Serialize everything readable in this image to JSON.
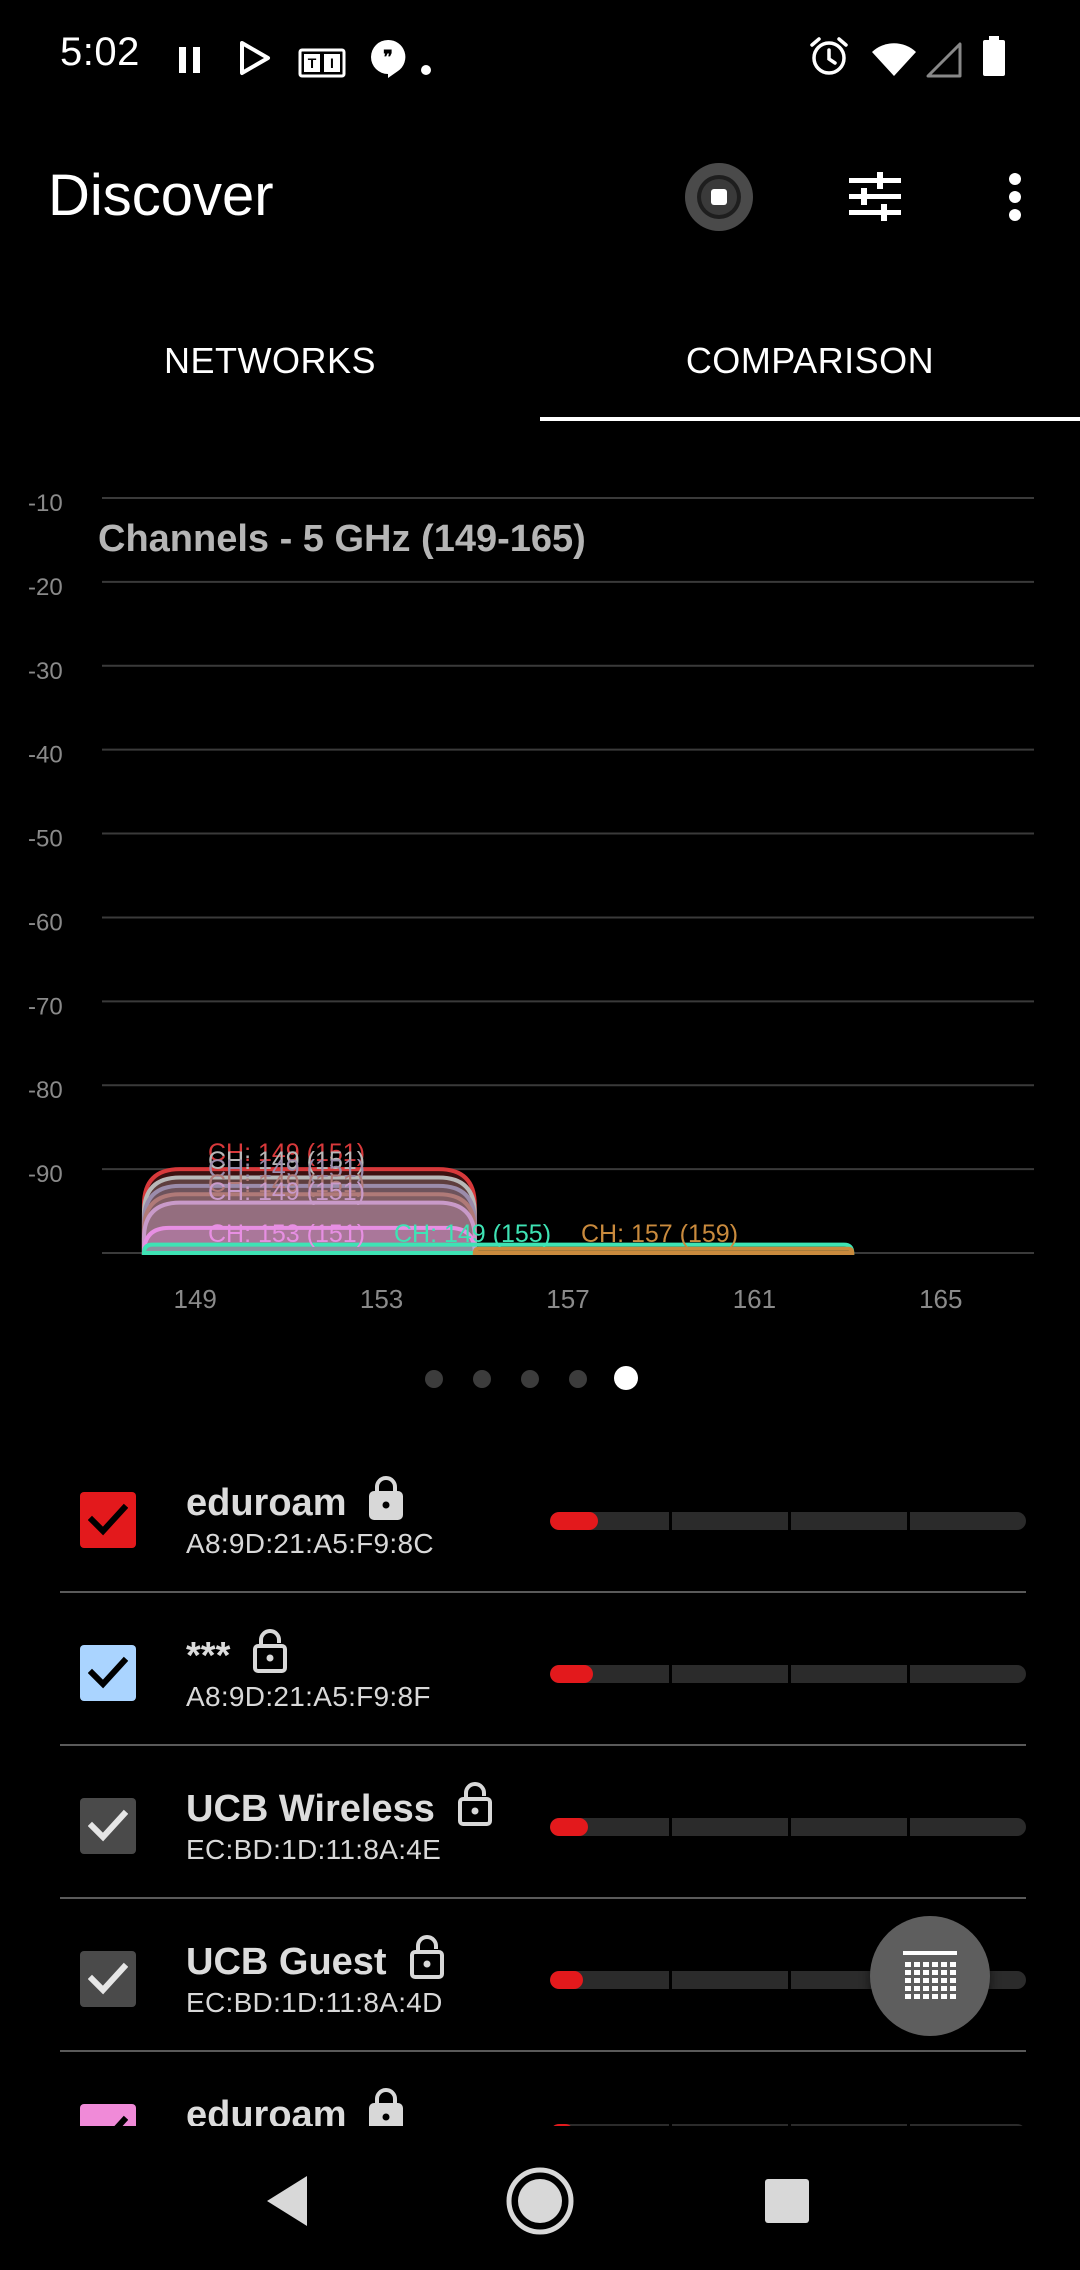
{
  "status_bar": {
    "time": "5:02",
    "icons": [
      "pause-icon",
      "play-icon",
      "news-icon",
      "chat-icon",
      "notification-dot-icon",
      "alarm-icon",
      "wifi-icon",
      "cell-signal-icon",
      "battery-icon"
    ]
  },
  "app_bar": {
    "title": "Discover",
    "actions": [
      "stop-scan-icon",
      "filter-sliders-icon",
      "more-vert-icon"
    ]
  },
  "tabs": [
    {
      "label": "NETWORKS",
      "selected": false
    },
    {
      "label": "COMPARISON",
      "selected": true
    }
  ],
  "chart_data": {
    "type": "area",
    "title": "Channels - 5 GHz (149-165)",
    "y_ticks": [
      "-10",
      "-20",
      "-30",
      "-40",
      "-50",
      "-60",
      "-70",
      "-80",
      "-90"
    ],
    "x_ticks": [
      "149",
      "153",
      "157",
      "161",
      "165"
    ],
    "ylim": [
      -100,
      -10
    ],
    "xlim": [
      147,
      167
    ],
    "grid": true,
    "series": [
      {
        "label": "CH: 149 (151)",
        "x_range": [
          147.9,
          155
        ],
        "rssi": -90,
        "color": "#d8393b"
      },
      {
        "label": "CH: 149 (151)",
        "x_range": [
          147.9,
          155
        ],
        "rssi": -91,
        "color": "#b8b8b8"
      },
      {
        "label": "CH: 149 (151)",
        "x_range": [
          147.9,
          155
        ],
        "rssi": -92,
        "color": "#9b8cab"
      },
      {
        "label": "CH: 149 (151)",
        "x_range": [
          147.9,
          155
        ],
        "rssi": -93,
        "color": "#b07a78"
      },
      {
        "label": "CH: 149 (151)",
        "x_range": [
          147.9,
          155
        ],
        "rssi": -94,
        "color": "#c99ac9"
      },
      {
        "label": "CH: 153 (151)",
        "x_range": [
          147.9,
          155
        ],
        "rssi": -97,
        "color": "#e78fe3"
      },
      {
        "label": "CH: 149 (155)",
        "x_range": [
          147.9,
          163.1
        ],
        "rssi": -99,
        "color": "#3ee3b4"
      },
      {
        "label": "CH: 157 (159)",
        "x_range": [
          155,
          163.1
        ],
        "rssi": -99.5,
        "color": "#c98a3d"
      }
    ]
  },
  "pager": {
    "count": 5,
    "active_index": 4
  },
  "networks": [
    {
      "ssid": "eduroam",
      "bssid": "A8:9D:21:A5:F9:8C",
      "checkbox_color": "#e3191c",
      "check_color": "#000000",
      "signal_fraction": 0.1,
      "locked": true
    },
    {
      "ssid": "***",
      "bssid": "A8:9D:21:A5:F9:8F",
      "checkbox_color": "#aad4ff",
      "check_color": "#000000",
      "signal_fraction": 0.09,
      "locked": false
    },
    {
      "ssid": "UCB Wireless",
      "bssid": "EC:BD:1D:11:8A:4E",
      "checkbox_color": "#4a4a4a",
      "check_color": "#e6e6e6",
      "signal_fraction": 0.08,
      "locked": false
    },
    {
      "ssid": "UCB Guest",
      "bssid": "EC:BD:1D:11:8A:4D",
      "checkbox_color": "#4a4a4a",
      "check_color": "#e6e6e6",
      "signal_fraction": 0.07,
      "locked": false
    },
    {
      "ssid": "eduroam",
      "bssid": "",
      "checkbox_color": "#f08ad8",
      "check_color": "#000000",
      "signal_fraction": 0.05,
      "locked": true
    }
  ],
  "fab": {
    "icon": "channel-grid-icon"
  },
  "nav_bar": {
    "buttons": [
      "back-icon",
      "home-icon",
      "recents-icon"
    ]
  }
}
